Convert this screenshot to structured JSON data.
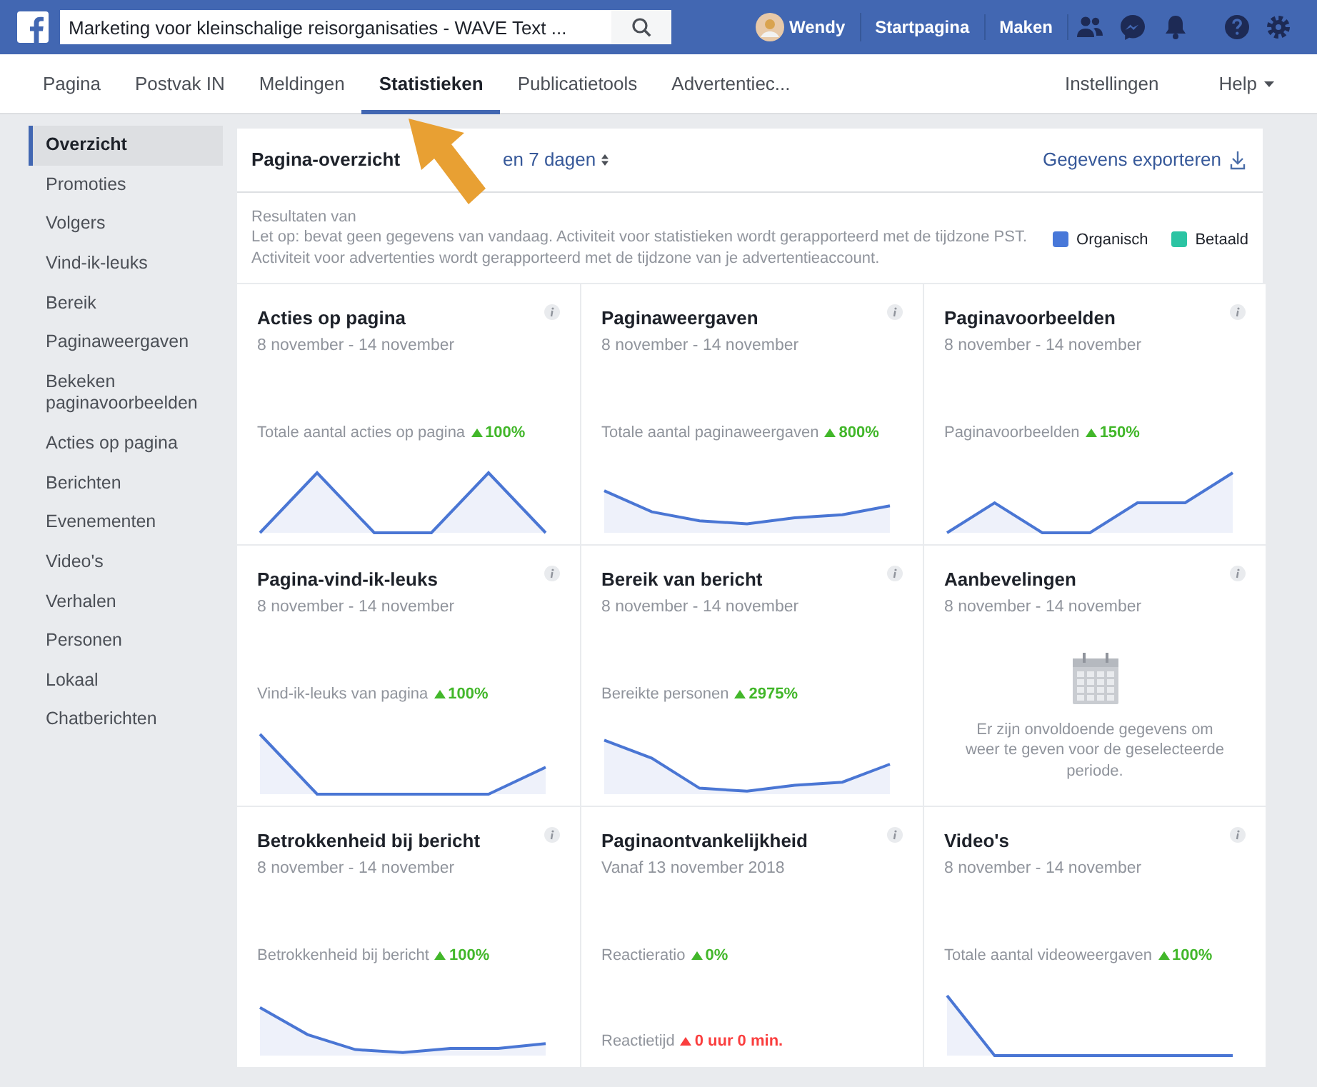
{
  "topbar": {
    "search_value": "Marketing voor kleinschalige reisorganisaties - WAVE Text ...",
    "user": "Wendy",
    "links": [
      "Startpagina",
      "Maken"
    ]
  },
  "tabs": [
    {
      "label": "Pagina",
      "selected": false
    },
    {
      "label": "Postvak IN",
      "selected": false
    },
    {
      "label": "Meldingen",
      "selected": false
    },
    {
      "label": "Statistieken",
      "selected": true
    },
    {
      "label": "Publicatietools",
      "selected": false
    },
    {
      "label": "Advertentiec...",
      "selected": false
    }
  ],
  "right_tabs": [
    {
      "label": "Instellingen",
      "dropdown": false
    },
    {
      "label": "Help",
      "dropdown": true
    }
  ],
  "sidebar": {
    "items": [
      {
        "label": "Overzicht",
        "selected": true
      },
      {
        "label": "Promoties",
        "selected": false
      },
      {
        "label": "Volgers",
        "selected": false
      },
      {
        "label": "Vind-ik-leuks",
        "selected": false
      },
      {
        "label": "Bereik",
        "selected": false
      },
      {
        "label": "Paginaweergaven",
        "selected": false
      },
      {
        "label": "Bekeken paginavoorbeelden",
        "selected": false
      },
      {
        "label": "Acties op pagina",
        "selected": false
      },
      {
        "label": "Berichten",
        "selected": false
      },
      {
        "label": "Evenementen",
        "selected": false
      },
      {
        "label": "Video's",
        "selected": false
      },
      {
        "label": "Verhalen",
        "selected": false
      },
      {
        "label": "Personen",
        "selected": false
      },
      {
        "label": "Lokaal",
        "selected": false
      },
      {
        "label": "Chatberichten",
        "selected": false
      }
    ]
  },
  "overview": {
    "title": "Pagina-overzicht",
    "date_range": "en 7 dagen",
    "export": "Gegevens exporteren",
    "results": "Resultaten van",
    "notes": [
      "Let op: bevat geen gegevens van vandaag. Activiteit voor statistieken wordt gerapporteerd met de tijdzone PST.",
      "Activiteit voor advertenties wordt gerapporteerd met de tijdzone van je advertentieaccount."
    ],
    "legend": [
      {
        "label": "Organisch",
        "color": "#4878d9"
      },
      {
        "label": "Betaald",
        "color": "#2bc4a3"
      }
    ]
  },
  "cards": [
    {
      "kind": "chart",
      "title": "Acties op pagina",
      "subtitle": "8 november - 14 november",
      "metrics": [
        {
          "label": "Totale aantal acties op pagina",
          "change": "100%",
          "warning": false
        }
      ]
    },
    {
      "kind": "chart",
      "title": "Paginaweergaven",
      "subtitle": "8 november - 14 november",
      "metrics": [
        {
          "label": "Totale aantal paginaweergaven",
          "change": "800%",
          "warning": false
        }
      ]
    },
    {
      "kind": "chart",
      "title": "Paginavoorbeelden",
      "subtitle": "8 november - 14 november",
      "metrics": [
        {
          "label": "Paginavoorbeelden",
          "change": "150%",
          "warning": false
        }
      ]
    },
    {
      "kind": "chart",
      "title": "Pagina-vind-ik-leuks",
      "subtitle": "8 november - 14 november",
      "metrics": [
        {
          "label": "Vind-ik-leuks van pagina",
          "change": "100%",
          "warning": false
        }
      ]
    },
    {
      "kind": "chart",
      "title": "Bereik van bericht",
      "subtitle": "8 november - 14 november",
      "metrics": [
        {
          "label": "Bereikte personen",
          "change": "2975%",
          "warning": false
        }
      ]
    },
    {
      "kind": "empty",
      "title": "Aanbevelingen",
      "subtitle": "8 november - 14 november",
      "message": "Er zijn onvoldoende gegevens om weer te geven voor de geselecteerde periode."
    },
    {
      "kind": "chart",
      "title": "Betrokkenheid bij bericht",
      "subtitle": "8 november - 14 november",
      "metrics": [
        {
          "label": "Betrokkenheid bij bericht",
          "change": "100%",
          "warning": false
        }
      ]
    },
    {
      "kind": "metrics",
      "title": "Paginaontvankelijkheid",
      "subtitle": "Vanaf 13 november 2018",
      "metrics": [
        {
          "label": "Reactieratio",
          "change": "0%",
          "warning": false
        },
        {
          "label": "Reactietijd",
          "change": "0 uur 0 min.",
          "warning": true
        }
      ]
    },
    {
      "kind": "chart",
      "title": "Video's",
      "subtitle": "8 november - 14 november",
      "metrics": [
        {
          "label": "Totale aantal videoweergaven",
          "change": "100%",
          "warning": false
        }
      ]
    }
  ]
}
